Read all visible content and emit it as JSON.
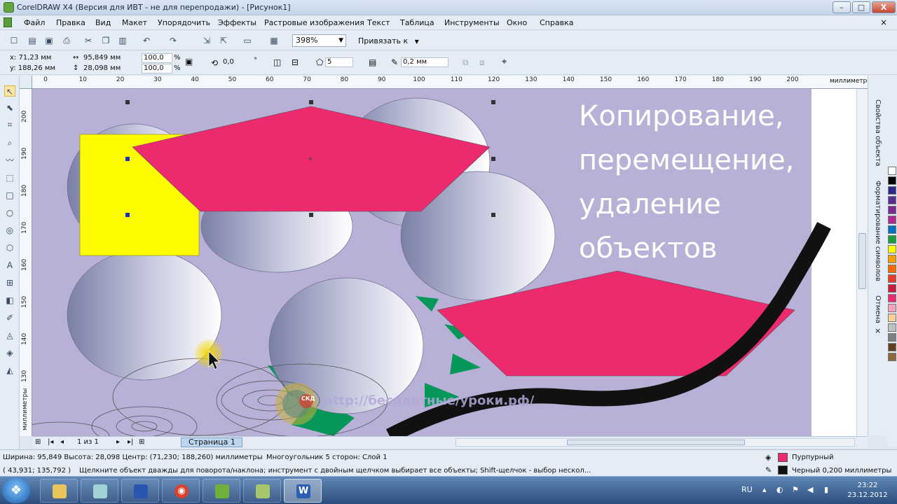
{
  "window": {
    "title": "CorelDRAW X4 (Версия для ИВТ - не для перепродажи) - [Рисунок1]",
    "min_glyph": "–",
    "max_glyph": "□",
    "close_glyph": "X"
  },
  "menu": {
    "items": [
      "Файл",
      "Правка",
      "Вид",
      "Макет",
      "Упорядочить",
      "Эффекты",
      "Растровые изображения",
      "Текст",
      "Таблица",
      "Инструменты",
      "Окно",
      "Справка"
    ],
    "close_glyph": "×"
  },
  "toolbar": {
    "zoom": "398%",
    "snap_label": "Привязать к"
  },
  "propbar": {
    "x": "x: 71,23 мм",
    "y": "y: 188,26 мм",
    "w": "95,849 мм",
    "h": "28,098 мм",
    "sx": "100,0",
    "sy": "100,0",
    "pct": "%",
    "angle": "0,0",
    "deg": "°",
    "sides": "5",
    "outline": "0,2 мм"
  },
  "rulers": {
    "top_ticks": [
      "0",
      "10",
      "20",
      "30",
      "40",
      "50",
      "60",
      "70",
      "80",
      "90",
      "100",
      "110",
      "120",
      "130",
      "140",
      "150",
      "160",
      "170",
      "180",
      "190",
      "200"
    ],
    "left_ticks": [
      "200",
      "190",
      "180",
      "170",
      "160",
      "150",
      "140",
      "130"
    ],
    "unit_top": "миллиметры",
    "unit_left": "миллиметры"
  },
  "canvas": {
    "heading_lines": [
      "Копирование,",
      "перемещение,",
      "удаление",
      "объектов"
    ],
    "watermark": "http://бесплатные/уроки.рф/",
    "logo_text": "СКД",
    "background": "#b8b0d6",
    "magenta": "#ee2a6f",
    "yellow": "#fffc00",
    "green": "#06975b"
  },
  "docker": {
    "tabs": [
      "Свойства объекта",
      "Форматирование символов",
      "Отмена"
    ]
  },
  "palette": {
    "colors": [
      "#ffffff",
      "#000000",
      "#2f2a86",
      "#5a2d91",
      "#7c2a92",
      "#b02a8e",
      "#0070c0",
      "#1a9e3c",
      "#ffff00",
      "#f5a000",
      "#ff6a00",
      "#e83b2d",
      "#c71c3a",
      "#ee2a6f",
      "#f5a3c0",
      "#ffcf99",
      "#c0c0c0",
      "#808080",
      "#604020",
      "#8a6a3a"
    ]
  },
  "pagebar": {
    "counter": "1 из 1",
    "page_tab": "Страница 1"
  },
  "status": {
    "dims": "Ширина: 95,849 Высота: 28,098 Центр: (71,230; 188,260) миллиметры",
    "object": "Многоугольник  5 сторон: Слой 1",
    "cursor": "( 43,931; 135,792 )",
    "hint": "Щелкните объект дважды для поворота/наклона; инструмент с двойным щелчком выбирает все объекты; Shift-щелчок - выбор нескол...",
    "fill_label": "Пурпурный",
    "fill_color": "#ee2a6f",
    "outline_label": "Черный  0,200 миллиметры",
    "outline_color": "#111111"
  },
  "taskbar": {
    "lang": "RU",
    "time": "23:22",
    "date": "23.12.2012",
    "word_glyph": "W",
    "chrome_glyph": "◉"
  }
}
